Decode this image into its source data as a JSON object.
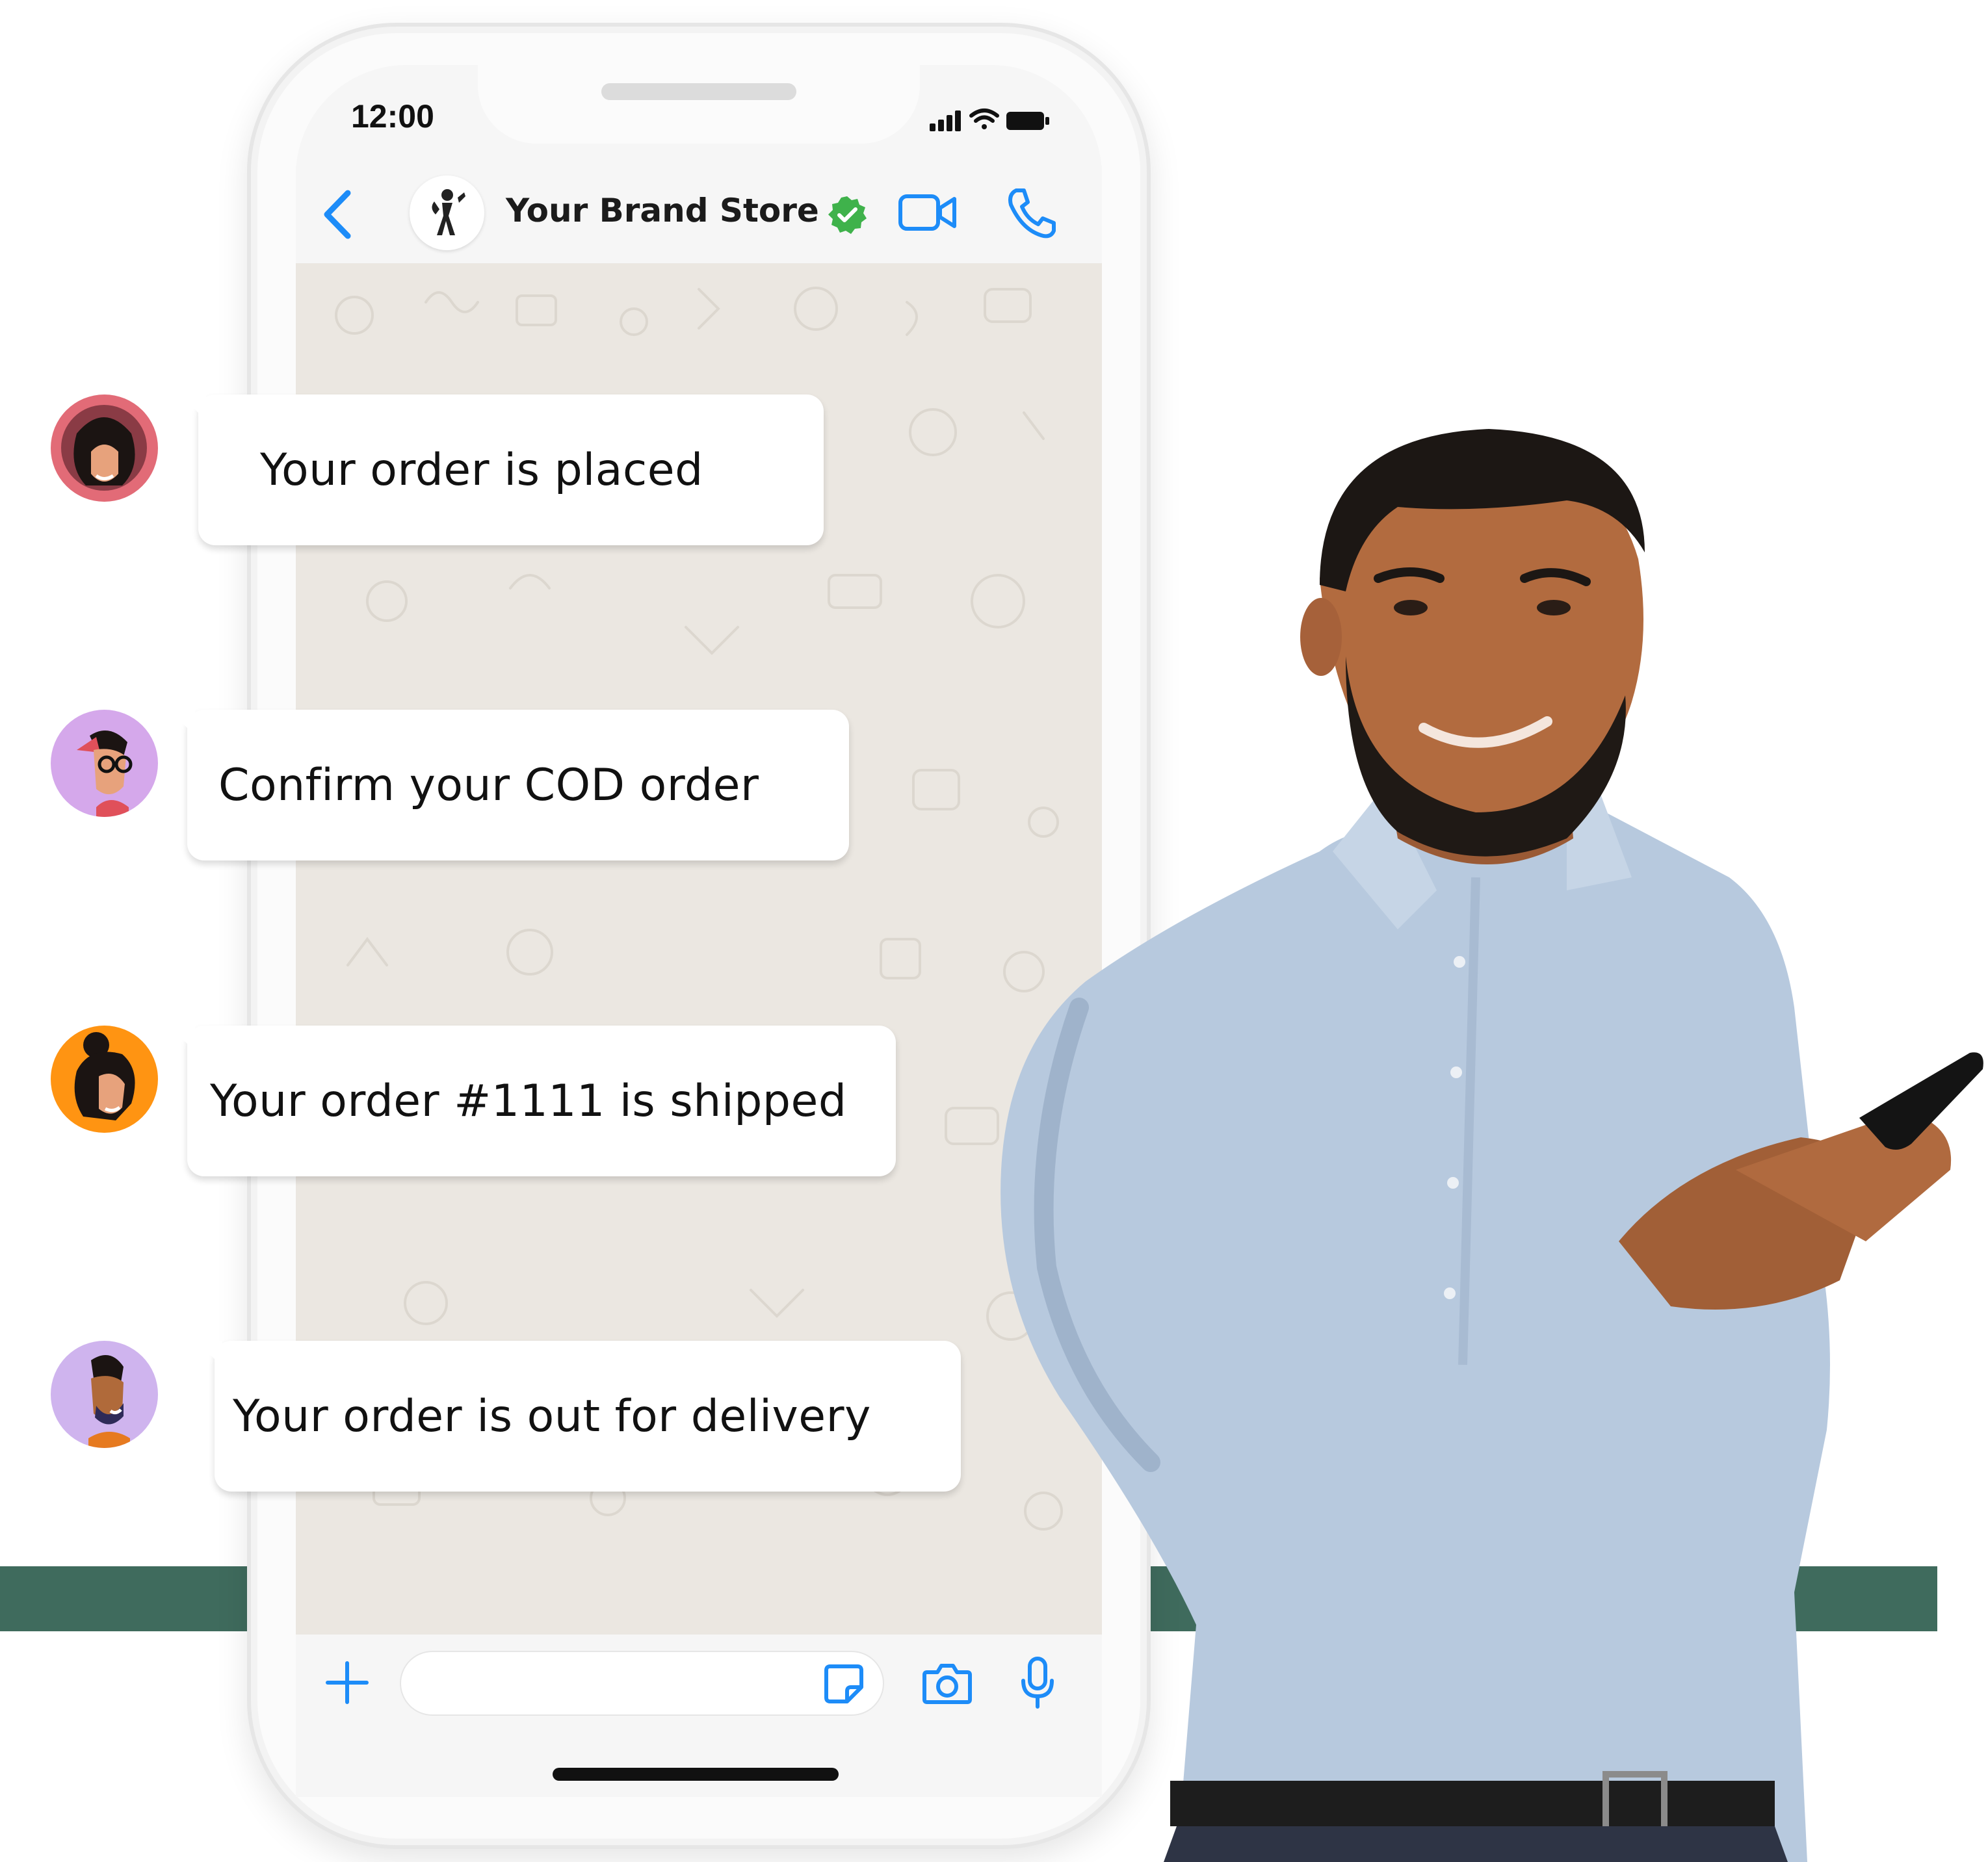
{
  "status_bar": {
    "time": "12:00"
  },
  "chat_header": {
    "brand_name": "Your Brand Store",
    "verified": true
  },
  "messages": [
    {
      "text": "Your order is placed"
    },
    {
      "text": "Confirm your COD order"
    },
    {
      "text": "Your order #1111 is shipped"
    },
    {
      "text": "Your order is out for delivery"
    }
  ],
  "input_bar": {
    "placeholder": ""
  },
  "colors": {
    "accent_blue": "#1d8cf8",
    "verified_green": "#3fb24b",
    "band_green": "#3f6b5d",
    "wallpaper": "#ebe7e1"
  },
  "icons": {
    "back": "chevron-left-icon",
    "video": "video-call-icon",
    "call": "phone-icon",
    "plus": "plus-icon",
    "sticker": "sticker-icon",
    "camera": "camera-icon",
    "mic": "microphone-icon"
  }
}
